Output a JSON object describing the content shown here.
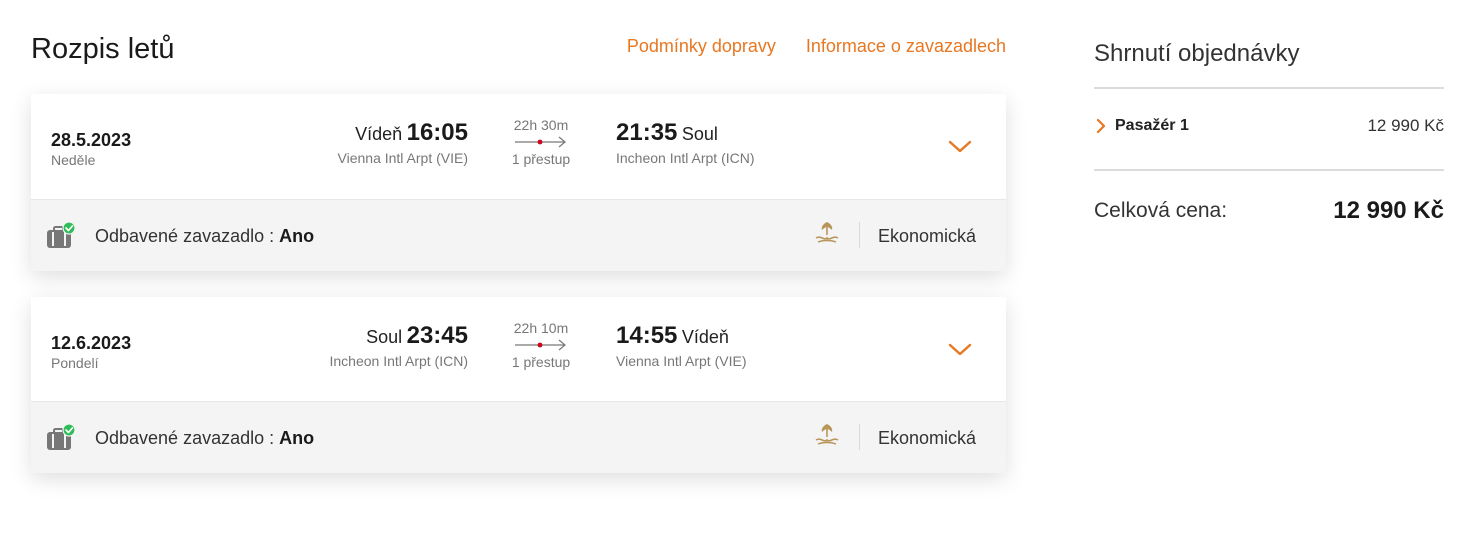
{
  "header": {
    "title": "Rozpis letů",
    "links": [
      "Podmínky dopravy",
      "Informace o zavazadlech"
    ]
  },
  "flights": [
    {
      "date": "28.5.2023",
      "weekday": "Neděle",
      "departure": {
        "city": "Vídeň",
        "time": "16:05",
        "airport": "Vienna Intl Arpt (VIE)"
      },
      "duration": "22h 30m",
      "stops": "1 přestup",
      "arrival": {
        "time": "21:35",
        "city": "Soul",
        "airport": "Incheon Intl Arpt (ICN)"
      },
      "baggage_label": "Odbavené zavazadlo :",
      "baggage_value": "Ano",
      "cabin": "Ekonomická"
    },
    {
      "date": "12.6.2023",
      "weekday": "Pondelí",
      "departure": {
        "city": "Soul",
        "time": "23:45",
        "airport": "Incheon Intl Arpt (ICN)"
      },
      "duration": "22h 10m",
      "stops": "1 přestup",
      "arrival": {
        "time": "14:55",
        "city": "Vídeň",
        "airport": "Vienna Intl Arpt (VIE)"
      },
      "baggage_label": "Odbavené zavazadlo :",
      "baggage_value": "Ano",
      "cabin": "Ekonomická"
    }
  ],
  "summary": {
    "title": "Shrnutí objednávky",
    "passenger_label": "Pasažér 1",
    "passenger_price": "12 990 Kč",
    "total_label": "Celková cena:",
    "total_value": "12 990 Kč"
  },
  "colors": {
    "accent": "#e87722",
    "stop_dot": "#d0021b",
    "check": "#2ebd59",
    "footer_bg": "#f4f4f4"
  },
  "icons": [
    "chevron-down-icon",
    "luggage-check-icon",
    "airline-logo-icon",
    "chevron-right-icon",
    "route-arrow-icon"
  ]
}
